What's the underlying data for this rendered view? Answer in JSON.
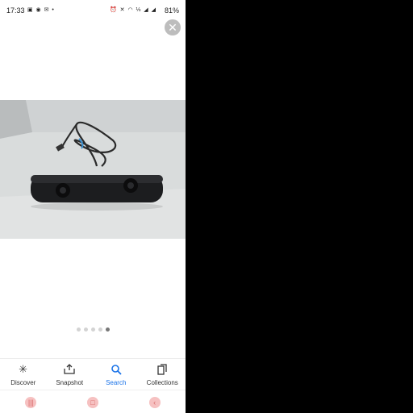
{
  "status_bar": {
    "time": "17:33",
    "left_icons": "▣ ◉ ✉ •",
    "right_icons": "⏰ ✕ ◠ ⅓ ◢ ◢",
    "battery": "81%"
  },
  "close_icon": "✕",
  "image": {
    "subject_icon": "camera-photo"
  },
  "carousel": {
    "total": 5,
    "active_index": 4
  },
  "bottom_nav": {
    "items": [
      {
        "label": "Discover",
        "icon": "asterisk-icon"
      },
      {
        "label": "Snapshot",
        "icon": "snapshot-icon"
      },
      {
        "label": "Search",
        "icon": "search-icon",
        "active": true
      },
      {
        "label": "Collections",
        "icon": "collections-icon"
      }
    ]
  },
  "system_nav": {
    "recents": "|||",
    "home": "□",
    "back": "‹"
  },
  "colors": {
    "accent": "#1a73e8",
    "background": "#ffffff"
  }
}
